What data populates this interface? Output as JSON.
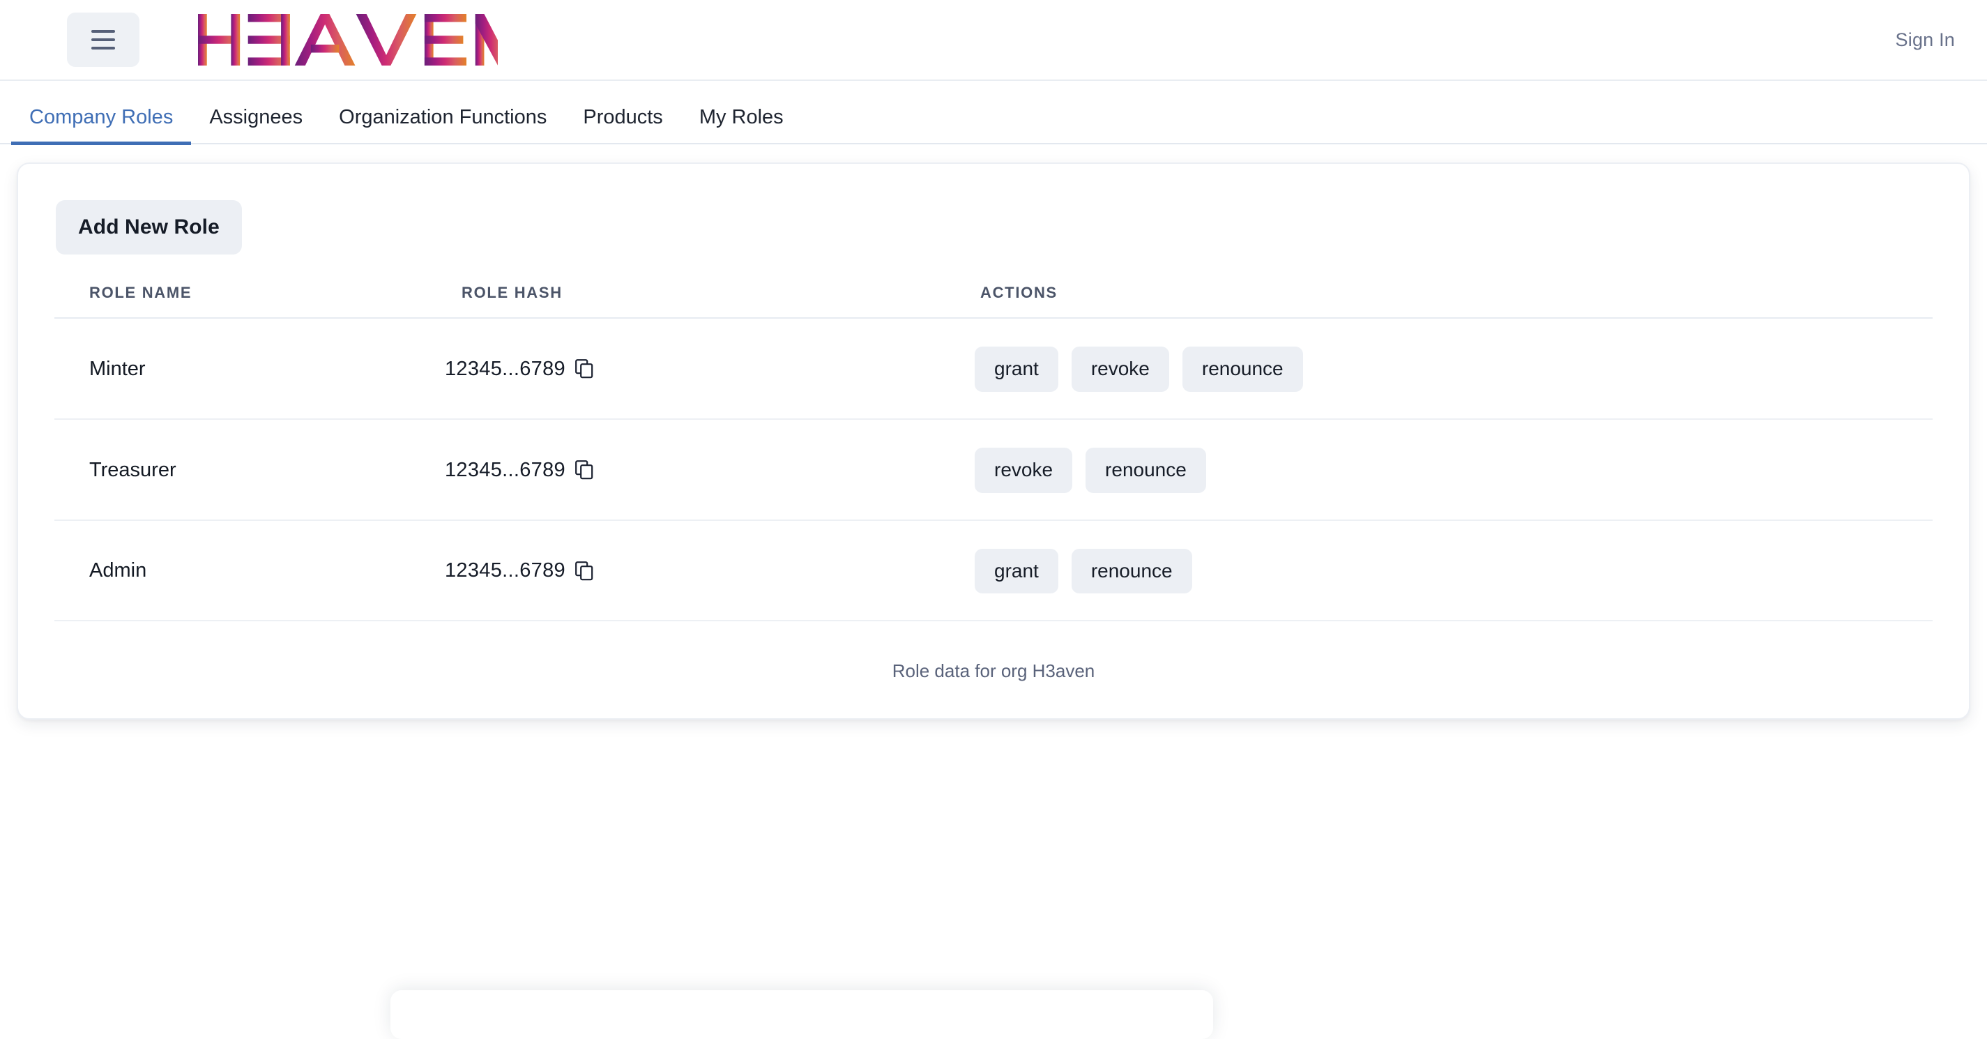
{
  "header": {
    "menu_icon": "hamburger-menu-icon",
    "brand_text": "HƎAVEN",
    "brand_plain": "H3AVEN",
    "brand_gradient": {
      "from": "#6b1f7a",
      "mid1": "#b01d7d",
      "mid2": "#d4386f",
      "mid3": "#d9565f",
      "to": "#e3812a"
    },
    "sign_in_label": "Sign In"
  },
  "tabs": {
    "active_index": 0,
    "items": [
      {
        "label": "Company Roles"
      },
      {
        "label": "Assignees"
      },
      {
        "label": "Organization Functions"
      },
      {
        "label": "Products"
      },
      {
        "label": "My Roles"
      }
    ]
  },
  "main": {
    "add_role_label": "Add New Role",
    "table": {
      "columns": [
        "ROLE NAME",
        "ROLE HASH",
        "ACTIONS"
      ],
      "rows": [
        {
          "name": "Minter",
          "hash": "12345...6789",
          "copy_icon": "copy-icon",
          "actions": [
            "grant",
            "revoke",
            "renounce"
          ]
        },
        {
          "name": "Treasurer",
          "hash": "12345...6789",
          "copy_icon": "copy-icon",
          "actions": [
            "revoke",
            "renounce"
          ]
        },
        {
          "name": "Admin",
          "hash": "12345...6789",
          "copy_icon": "copy-icon",
          "actions": [
            "grant",
            "renounce"
          ]
        }
      ]
    },
    "footnote": "Role data for org H3aven"
  },
  "colors": {
    "accent_blue": "#3f6eb5",
    "button_bg": "#eceff4",
    "text_dark": "#161c27",
    "text_muted": "#59627a",
    "border": "#e7ebf1"
  }
}
